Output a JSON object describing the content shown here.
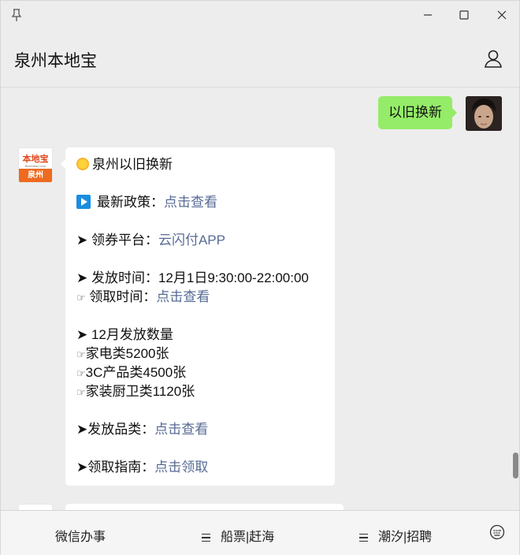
{
  "header": {
    "title": "泉州本地宝"
  },
  "messages": {
    "me": {
      "text": "以旧换新"
    },
    "bot": {
      "avatar_logo": "本地宝",
      "avatar_sub": "BenDibao.com",
      "avatar_city": "泉州",
      "title": "泉州以旧换新",
      "policy_label": "最新政策：",
      "policy_link": "点击查看",
      "platform_label": "➤ 领券平台：",
      "platform_link": "云闪付APP",
      "issue_time": "➤ 发放时间：12月1日9:30:00-22:00:00",
      "claim_label": "领取时间：",
      "claim_link": "点击查看",
      "quantity_title": "➤ 12月发放数量",
      "quantity_items": [
        "家电类5200张",
        "3C产品类4500张",
        "家装厨卫类1120张"
      ],
      "category_label": "➤发放品类：",
      "category_link": "点击查看",
      "guide_label": "➤领取指南：",
      "guide_link": "点击领取"
    }
  },
  "bottom_menu": {
    "item1": "微信办事",
    "item2": "船票|赶海",
    "item3": "潮汐|招聘"
  }
}
